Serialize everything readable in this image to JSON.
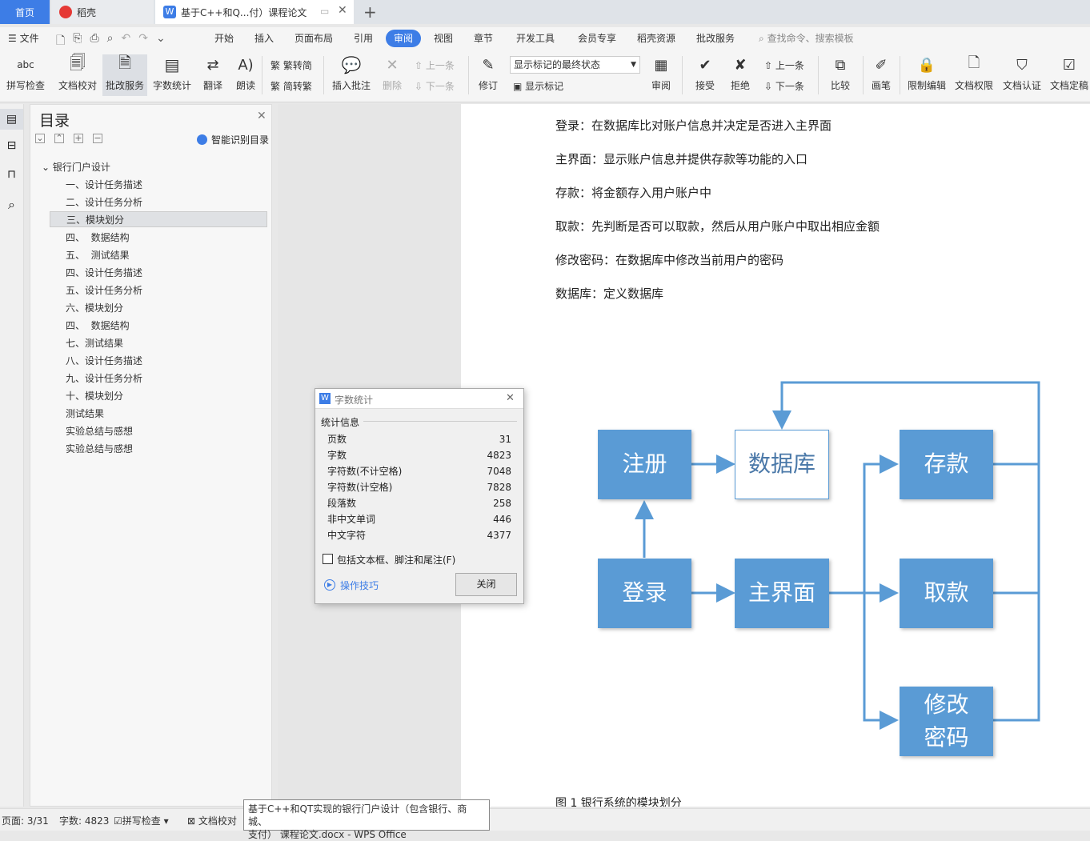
{
  "tabs": {
    "home": "首页",
    "daoke": "稻壳",
    "doc": "基于C++和Q...付）课程论文"
  },
  "menu": {
    "file": "文件",
    "items": [
      "开始",
      "插入",
      "页面布局",
      "引用",
      "审阅",
      "视图",
      "章节",
      "开发工具",
      "会员专享",
      "稻壳资源",
      "批改服务"
    ],
    "search": "查找命令、搜索模板"
  },
  "ribbon": {
    "spell": "拼写检查",
    "proof": "文档校对",
    "review_service": "批改服务",
    "word_count": "字数统计",
    "translate": "翻译",
    "read": "朗读",
    "trad_simp": "繁转简",
    "simp_trad": "简转繁",
    "insert_comment": "插入批注",
    "delete": "删除",
    "prev": "上一条",
    "next": "下一条",
    "track": "修订",
    "markup_select": "显示标记的最终状态",
    "show_markup": "显示标记",
    "review": "审阅",
    "accept": "接受",
    "reject": "拒绝",
    "prev2": "上一条",
    "next2": "下一条",
    "compare": "比较",
    "pen": "画笔",
    "restrict": "限制编辑",
    "perm": "文档权限",
    "cert": "文档认证",
    "final": "文档定稿"
  },
  "toc": {
    "title": "目录",
    "smart": "智能识别目录",
    "root": "银行门户设计",
    "items": [
      "一、设计任务描述",
      "二、设计任务分析",
      "三、模块划分",
      "四、  数据结构",
      "五、  测试结果",
      "四、设计任务描述",
      "五、设计任务分析",
      "六、模块划分",
      "四、  数据结构",
      "七、测试结果",
      "八、设计任务描述",
      "九、设计任务分析",
      "十、模块划分"
    ],
    "level1": [
      "测试结果",
      "实验总结与感想",
      "实验总结与感想"
    ]
  },
  "doc": {
    "paras": [
      "登录：在数据库比对账户信息并决定是否进入主界面",
      "主界面：显示账户信息并提供存款等功能的入口",
      "存款：将金额存入用户账户中",
      "取款：先判断是否可以取款，然后从用户账户中取出相应金额",
      "修改密码：在数据库中修改当前用户的密码",
      "数据库：定义数据库"
    ],
    "nodes": {
      "register": "注册",
      "db": "数据库",
      "deposit": "存款",
      "login": "登录",
      "main": "主界面",
      "withdraw": "取款",
      "pwd1": "修改",
      "pwd2": "密码"
    },
    "caption": "图 1 银行系统的模块划分"
  },
  "dialog": {
    "title": "字数统计",
    "section": "统计信息",
    "rows": [
      [
        "页数",
        "31"
      ],
      [
        "字数",
        "4823"
      ],
      [
        "字符数(不计空格)",
        "7048"
      ],
      [
        "字符数(计空格)",
        "7828"
      ],
      [
        "段落数",
        "258"
      ],
      [
        "非中文单词",
        "446"
      ],
      [
        "中文字符",
        "4377"
      ]
    ],
    "checkbox": "包括文本框、脚注和尾注(F)",
    "tips": "操作技巧",
    "close": "关闭"
  },
  "status": {
    "page": "页面: 3/31",
    "words": "字数: 4823",
    "spell": "拼写检查",
    "proof": "文档校对"
  },
  "tooltip": {
    "line1": "基于C++和QT实现的银行门户设计（包含银行、商城、",
    "line2": "支付） 课程论文.docx - WPS Office"
  }
}
